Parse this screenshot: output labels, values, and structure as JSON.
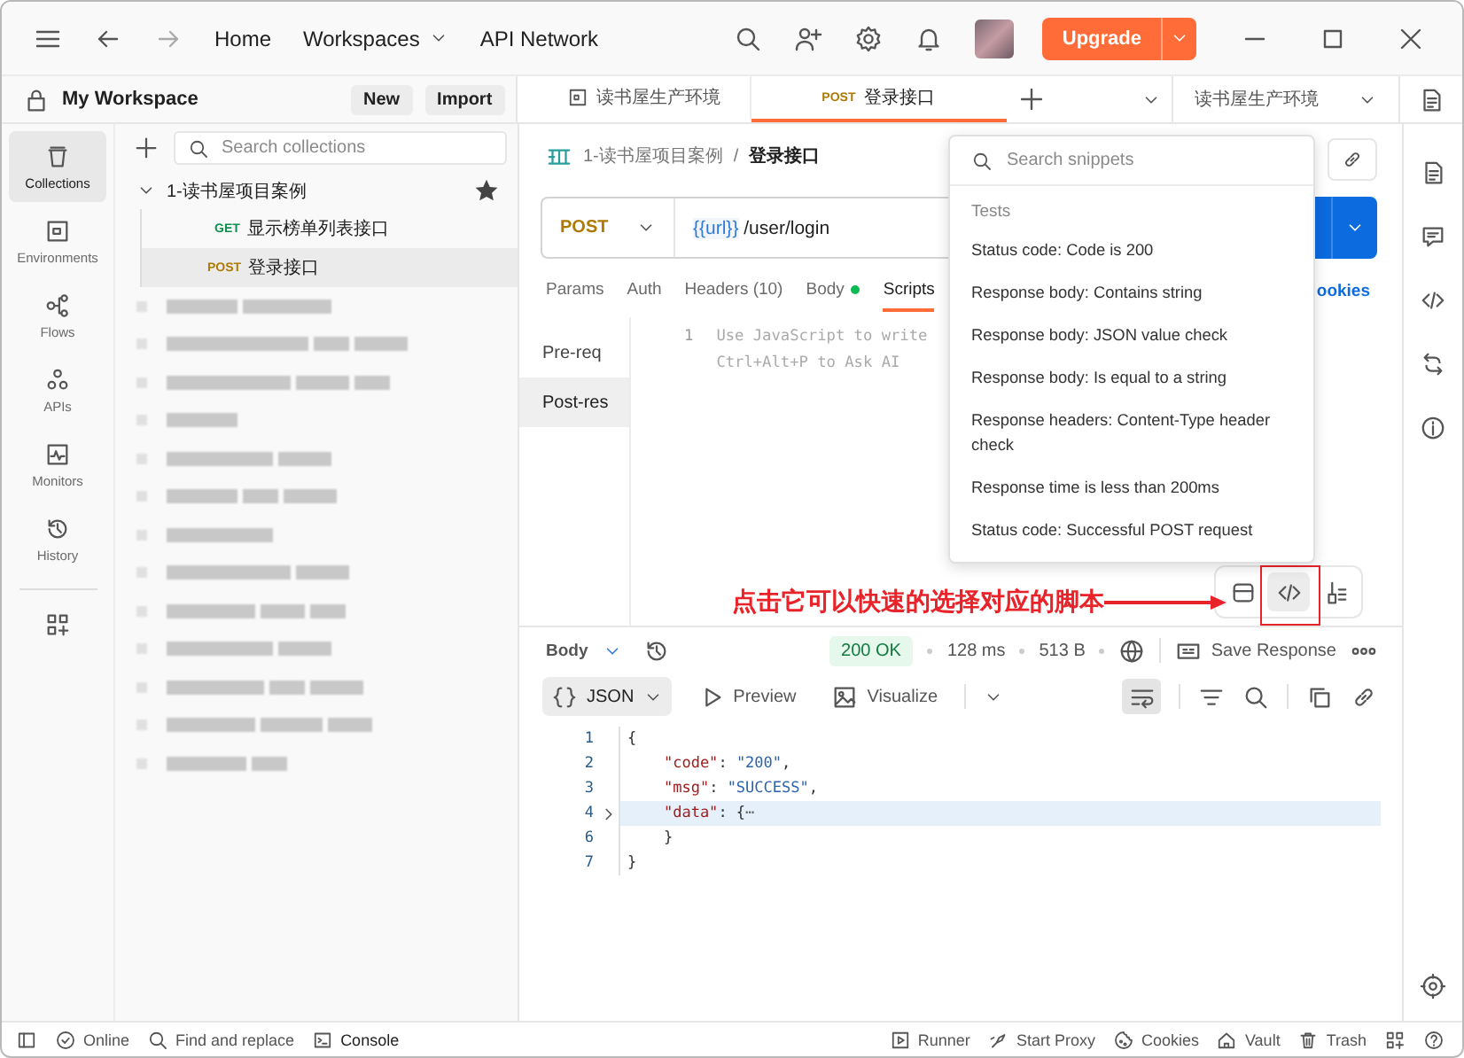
{
  "top_bar": {
    "nav": [
      "Home",
      "Workspaces",
      "API Network"
    ],
    "upgrade": "Upgrade"
  },
  "workspace": {
    "title": "My Workspace",
    "buttons": [
      "New",
      "Import"
    ]
  },
  "tabs": [
    {
      "kind": "environment",
      "label": "读书屋生产环境",
      "selected": false
    },
    {
      "kind": "request",
      "method": "POST",
      "label": "登录接口",
      "selected": true
    }
  ],
  "environment_select": {
    "value": "读书屋生产环境"
  },
  "sidebar": {
    "items": [
      {
        "label": "Collections",
        "selected": true
      },
      {
        "label": "Environments",
        "selected": false
      },
      {
        "label": "Flows",
        "selected": false
      },
      {
        "label": "APIs",
        "selected": false
      },
      {
        "label": "Monitors",
        "selected": false
      },
      {
        "label": "History",
        "selected": false
      }
    ]
  },
  "collections_search": {
    "placeholder": "Search collections"
  },
  "collections": [
    {
      "kind": "collection",
      "name": "1-读书屋项目案例",
      "expanded": true,
      "starred": true,
      "children": [
        {
          "method": "GET",
          "name": "显示榜单列表接口",
          "selected": false
        },
        {
          "method": "POST",
          "name": "登录接口",
          "selected": true
        }
      ]
    },
    {
      "kind": "redacted"
    },
    {
      "kind": "redacted"
    },
    {
      "kind": "redacted"
    },
    {
      "kind": "redacted"
    },
    {
      "kind": "redacted"
    },
    {
      "kind": "redacted"
    },
    {
      "kind": "redacted"
    },
    {
      "kind": "redacted"
    },
    {
      "kind": "redacted"
    },
    {
      "kind": "redacted"
    },
    {
      "kind": "redacted"
    },
    {
      "kind": "redacted"
    },
    {
      "kind": "redacted"
    }
  ],
  "breadcrumb": [
    "1-读书屋项目案例",
    "/",
    "登录接口"
  ],
  "request": {
    "method": "POST",
    "variable": "{{url}}",
    "path": "/user/login"
  },
  "request_tabs": [
    {
      "label": "Params",
      "selected": false,
      "dot": false
    },
    {
      "label": "Auth",
      "selected": false,
      "dot": false
    },
    {
      "label": "Headers (10)",
      "selected": false,
      "dot": false
    },
    {
      "label": "Body",
      "selected": false,
      "dot": true
    },
    {
      "label": "Scripts",
      "selected": true,
      "dot": false
    }
  ],
  "cookies_link": "ookies",
  "script_tabs": [
    {
      "label": "Pre-req",
      "selected": false
    },
    {
      "label": "Post-res",
      "selected": true
    }
  ],
  "editor": {
    "line_number": "1",
    "hint": [
      "Use JavaScript to write",
      "Ctrl+Alt+P to Ask AI"
    ]
  },
  "snippets": {
    "placeholder": "Search snippets",
    "section": "Tests",
    "items": [
      "Status code: Code is 200",
      "Response body: Contains string",
      "Response body: JSON value check",
      "Response body: Is equal to a string",
      "Response headers: Content-Type header check",
      "Response time is less than 200ms",
      "Status code: Successful POST request"
    ]
  },
  "editor_tools": [
    {
      "kind": "sidebar",
      "selected": false
    },
    {
      "kind": "code",
      "selected": true
    },
    {
      "kind": "broom",
      "selected": false
    }
  ],
  "annotation": "点击它可以快速的选择对应的脚本",
  "response": {
    "view": "Body",
    "status": "200 OK",
    "time": "128 ms",
    "size": "513 B",
    "save": "Save Response",
    "formats": [
      {
        "label": "JSON",
        "selected": true
      },
      {
        "label": "Preview",
        "selected": false
      },
      {
        "label": "Visualize",
        "selected": false
      }
    ],
    "wrap_on": true,
    "lines": [
      {
        "number": "1",
        "kind": "plain",
        "highlighted": false,
        "tokens": [
          {
            "kind": "punct",
            "text": "{"
          }
        ]
      },
      {
        "number": "2",
        "kind": "plain",
        "highlighted": false,
        "tokens": [
          {
            "kind": "key",
            "text": "    \"code\""
          },
          {
            "kind": "punct",
            "text": ": "
          },
          {
            "kind": "string",
            "text": "\"200\""
          },
          {
            "kind": "punct",
            "text": ","
          }
        ]
      },
      {
        "number": "3",
        "kind": "plain",
        "highlighted": false,
        "tokens": [
          {
            "kind": "key",
            "text": "    \"msg\""
          },
          {
            "kind": "punct",
            "text": ": "
          },
          {
            "kind": "string",
            "text": "\"SUCCESS\""
          },
          {
            "kind": "punct",
            "text": ","
          }
        ]
      },
      {
        "number": "4",
        "kind": "folded",
        "highlighted": true,
        "tokens": [
          {
            "kind": "key",
            "text": "    \"data\""
          },
          {
            "kind": "punct",
            "text": ": {"
          },
          {
            "kind": "ellipsis",
            "text": "⋯"
          }
        ]
      },
      {
        "number": "6",
        "kind": "plain",
        "highlighted": false,
        "tokens": [
          {
            "kind": "punct",
            "text": "    }"
          }
        ]
      },
      {
        "number": "7",
        "kind": "plain",
        "highlighted": false,
        "tokens": [
          {
            "kind": "punct",
            "text": "}"
          }
        ]
      }
    ]
  },
  "status_bar": {
    "left": [
      "Online",
      "Find and replace",
      "Console"
    ],
    "right": [
      "Runner",
      "Start Proxy",
      "Cookies",
      "Vault",
      "Trash"
    ]
  }
}
